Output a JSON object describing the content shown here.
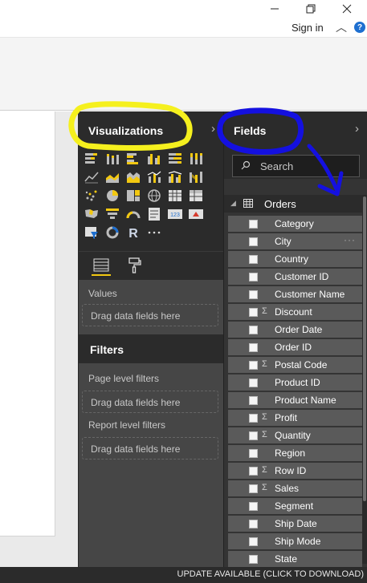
{
  "window": {
    "sign_in": "Sign in",
    "help": "?"
  },
  "visualizations": {
    "title": "Visualizations",
    "values_label": "Values",
    "values_dropzone": "Drag data fields here"
  },
  "filters": {
    "title": "Filters",
    "page_level_label": "Page level filters",
    "page_level_dropzone": "Drag data fields here",
    "report_level_label": "Report level filters",
    "report_level_dropzone": "Drag data fields here"
  },
  "fields": {
    "title": "Fields",
    "search_placeholder": "Search",
    "table_name": "Orders",
    "items": [
      {
        "label": "Category",
        "sigma": ""
      },
      {
        "label": "City",
        "sigma": ""
      },
      {
        "label": "Country",
        "sigma": ""
      },
      {
        "label": "Customer ID",
        "sigma": ""
      },
      {
        "label": "Customer Name",
        "sigma": ""
      },
      {
        "label": "Discount",
        "sigma": "Σ"
      },
      {
        "label": "Order Date",
        "sigma": ""
      },
      {
        "label": "Order ID",
        "sigma": ""
      },
      {
        "label": "Postal Code",
        "sigma": "Σ"
      },
      {
        "label": "Product ID",
        "sigma": ""
      },
      {
        "label": "Product Name",
        "sigma": ""
      },
      {
        "label": "Profit",
        "sigma": "Σ"
      },
      {
        "label": "Quantity",
        "sigma": "Σ"
      },
      {
        "label": "Region",
        "sigma": ""
      },
      {
        "label": "Row ID",
        "sigma": "Σ"
      },
      {
        "label": "Sales",
        "sigma": "Σ"
      },
      {
        "label": "Segment",
        "sigma": ""
      },
      {
        "label": "Ship Date",
        "sigma": ""
      },
      {
        "label": "Ship Mode",
        "sigma": ""
      },
      {
        "label": "State",
        "sigma": ""
      }
    ]
  },
  "status": {
    "update": "UPDATE AVAILABLE (CLICK TO DOWNLOAD)"
  },
  "colors": {
    "annotation_yellow": "#f5f01e",
    "annotation_blue": "#1410e0",
    "accent_yellow": "#f2c811",
    "pane_dark": "#2b2b2b"
  }
}
